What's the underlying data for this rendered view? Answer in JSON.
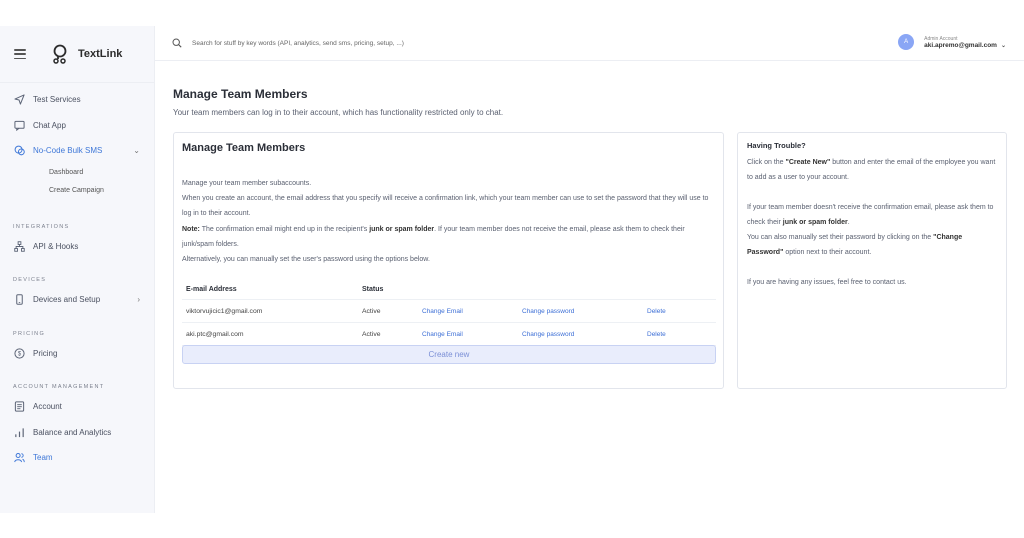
{
  "brand": {
    "name": "TextLink"
  },
  "sidebar": {
    "items_top": [
      {
        "label": "Test Services",
        "icon": "send-icon"
      },
      {
        "label": "Chat App",
        "icon": "chat-icon"
      },
      {
        "label": "No-Code Bulk SMS",
        "icon": "sms-icon"
      }
    ],
    "sub_items": [
      "Dashboard",
      "Create Campaign"
    ],
    "sections": {
      "integrations": "INTEGRATIONS",
      "devices": "DEVICES",
      "pricing": "PRICING",
      "account": "ACCOUNT MANAGEMENT"
    },
    "api_hooks": "API & Hooks",
    "devices_setup": "Devices and Setup",
    "pricing": "Pricing",
    "account": "Account",
    "balance": "Balance and Analytics",
    "team": "Team"
  },
  "search": {
    "placeholder": "Search for stuff by key words (API, analytics, send sms, pricing, setup, ...)"
  },
  "user": {
    "initial": "A",
    "role": "Admin Account",
    "email": "aki.apremo@gmail.com"
  },
  "page": {
    "title": "Manage Team Members",
    "subtitle": "Your team members can log in to their account, which has functionality restricted only to chat."
  },
  "card": {
    "title": "Manage Team Members",
    "p1": "Manage your team member subaccounts.",
    "p2": "When you create an account, the email address that you specify will receive a confirmation link, which your team member can use to set the password that they will use to log in to their account.",
    "note_label": "Note:",
    "note_a": " The confirmation email might end up in the recipient's ",
    "note_bold": "junk or spam folder",
    "note_b": ". If your team member does not receive the email, please ask them to check their junk/spam folders.",
    "p3": "Alternatively, you can manually set the user's password using the options below.",
    "col_email": "E-mail Address",
    "col_status": "Status",
    "rows": [
      {
        "email": "viktorvujicic1@gmail.com",
        "status": "Active",
        "change_email": "Change Email",
        "change_password": "Change password",
        "delete": "Delete"
      },
      {
        "email": "aki.ptc@gmail.com",
        "status": "Active",
        "change_email": "Change Email",
        "change_password": "Change password",
        "delete": "Delete"
      }
    ],
    "create_label": "Create new"
  },
  "help": {
    "title": "Having Trouble?",
    "l1a": "Click on the ",
    "l1b": "\"Create New\"",
    "l1c": " button and enter the email of the employee you want to add as a user to your account.",
    "l2a": "If your team member doesn't receive the confirmation email, please ask them to check their ",
    "l2b": "junk or spam folder",
    "l2c": ".",
    "l3a": "You can also manually set their password by clicking on the ",
    "l3b": "\"Change Password\"",
    "l3c": " option next to their account.",
    "l4": "If you are having any issues, feel free to contact us."
  },
  "colors": {
    "accent": "#3d6fd6",
    "button_bg": "#e9edfc",
    "sidebar_bg": "#f6f7fb"
  }
}
